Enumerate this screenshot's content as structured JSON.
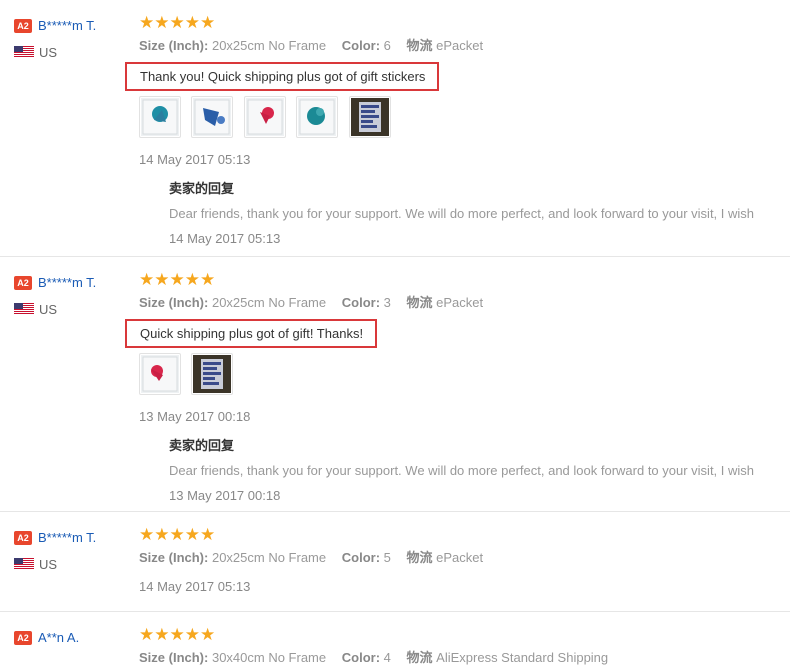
{
  "reviews": [
    {
      "badge": "A2",
      "user": "B*****m T.",
      "country": "US",
      "stars": "★★★★★",
      "size_label": "Size (Inch):",
      "size_value": "20x25cm No Frame",
      "color_label": "Color:",
      "color_value": "6",
      "ship_label": "物流",
      "ship_value": "ePacket",
      "text": "Thank you! Quick shipping plus got of gift stickers",
      "photo_colors": [
        "#1f8fa6",
        "#2a5ea8",
        "#d8264b",
        "#1b8a95",
        "#3a4a8a"
      ],
      "date": "14 May 2017 05:13",
      "reply_title": "卖家的回复",
      "reply_text": "Dear friends, thank you for your support. We will do more perfect, and look forward to your visit, I wish",
      "reply_date": "14 May 2017 05:13"
    },
    {
      "badge": "A2",
      "user": "B*****m T.",
      "country": "US",
      "stars": "★★★★★",
      "size_label": "Size (Inch):",
      "size_value": "20x25cm No Frame",
      "color_label": "Color:",
      "color_value": "3",
      "ship_label": "物流",
      "ship_value": "ePacket",
      "text": "Quick shipping plus got of gift! Thanks!",
      "photo_colors": [
        "#d8264b",
        "#3a4a8a"
      ],
      "date": "13 May 2017 00:18",
      "reply_title": "卖家的回复",
      "reply_text": "Dear friends, thank you for your support. We will do more perfect, and look forward to your visit, I wish",
      "reply_date": "13 May 2017 00:18"
    },
    {
      "badge": "A2",
      "user": "B*****m T.",
      "country": "US",
      "stars": "★★★★★",
      "size_label": "Size (Inch):",
      "size_value": "20x25cm No Frame",
      "color_label": "Color:",
      "color_value": "5",
      "ship_label": "物流",
      "ship_value": "ePacket",
      "date": "14 May 2017 05:13"
    },
    {
      "badge": "A2",
      "user": "A**n A.",
      "country": "US",
      "stars": "★★★★★",
      "size_label": "Size (Inch):",
      "size_value": "30x40cm No Frame",
      "color_label": "Color:",
      "color_value": "4",
      "ship_label": "物流",
      "ship_value": "AliExpress Standard Shipping"
    }
  ]
}
